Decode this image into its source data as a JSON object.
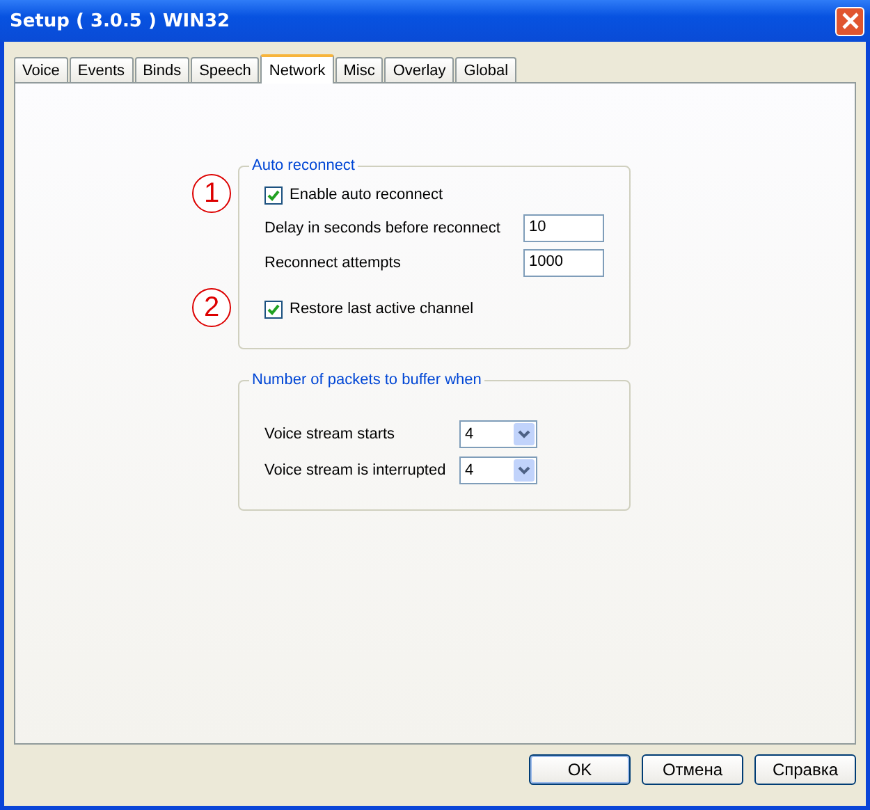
{
  "window": {
    "title": "Setup ( 3.0.5 ) WIN32"
  },
  "tabs": [
    {
      "label": "Voice",
      "selected": false
    },
    {
      "label": "Events",
      "selected": false
    },
    {
      "label": "Binds",
      "selected": false
    },
    {
      "label": "Speech",
      "selected": false
    },
    {
      "label": "Network",
      "selected": true
    },
    {
      "label": "Misc",
      "selected": false
    },
    {
      "label": "Overlay",
      "selected": false
    },
    {
      "label": "Global",
      "selected": false
    }
  ],
  "groups": [
    {
      "title": "Auto reconnect",
      "rows": [
        {
          "kind": "checkbox",
          "label": "Enable auto reconnect",
          "checked": true,
          "annotation": "1"
        },
        {
          "kind": "input",
          "label": "Delay in seconds before reconnect",
          "value": "10"
        },
        {
          "kind": "input",
          "label": "Reconnect attempts",
          "value": "1000"
        },
        {
          "kind": "checkbox",
          "label": "Restore last active channel",
          "checked": true,
          "annotation": "2"
        }
      ]
    },
    {
      "title": "Number of packets to buffer when",
      "rows": [
        {
          "kind": "select",
          "label": "Voice stream starts",
          "value": "4"
        },
        {
          "kind": "select",
          "label": "Voice stream is interrupted",
          "value": "4"
        }
      ]
    }
  ],
  "buttons": [
    "OK",
    "Отмена",
    "Справка"
  ]
}
